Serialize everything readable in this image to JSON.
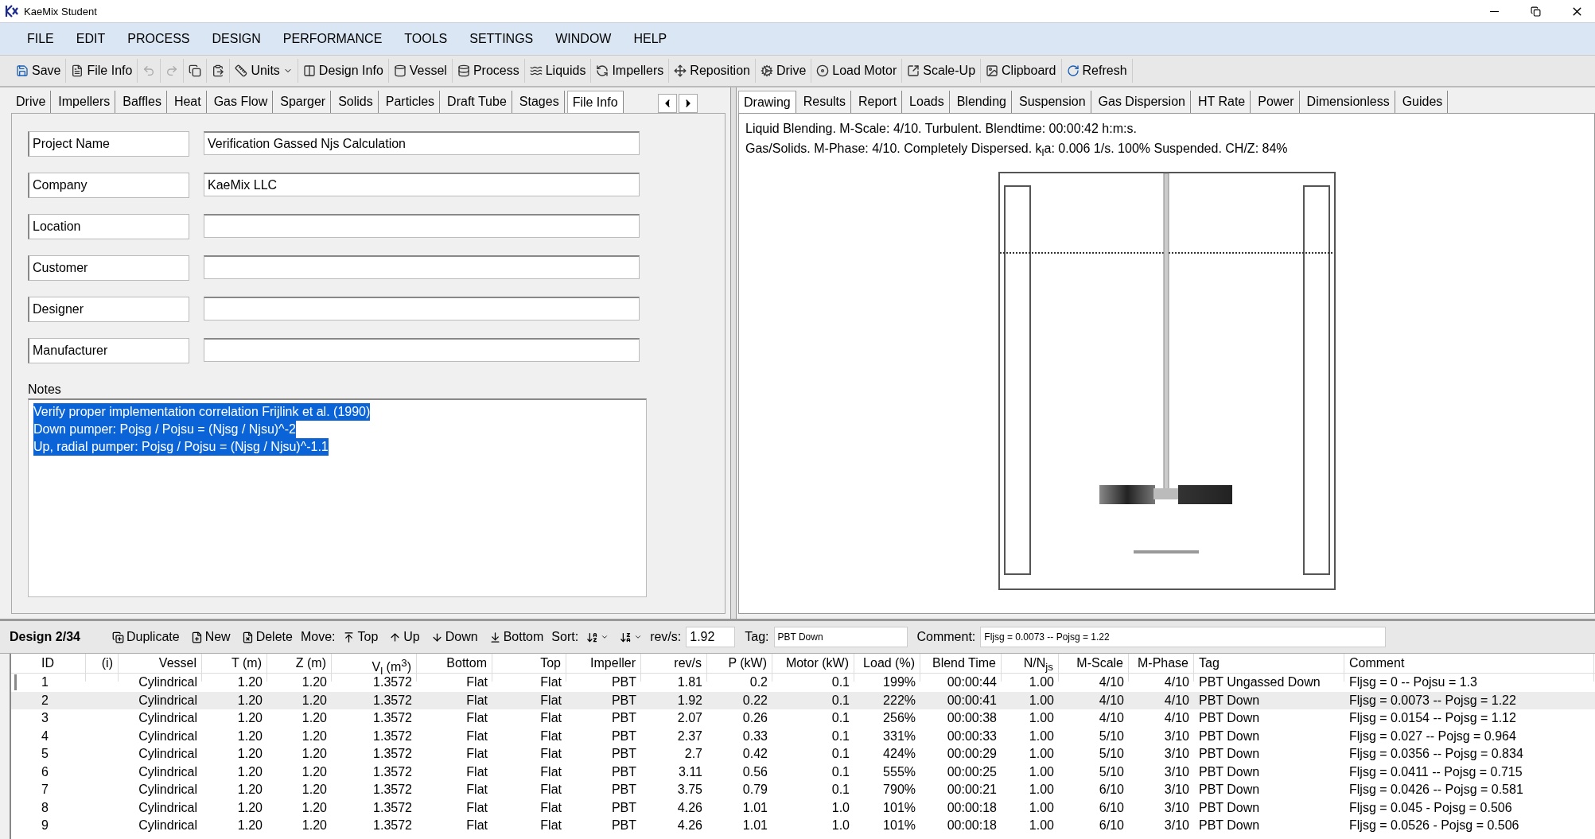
{
  "window": {
    "title": "KaeMix Student"
  },
  "menu": [
    "FILE",
    "EDIT",
    "PROCESS",
    "DESIGN",
    "PERFORMANCE",
    "TOOLS",
    "SETTINGS",
    "WINDOW",
    "HELP"
  ],
  "toolbar": [
    {
      "label": "Save",
      "disabled": false,
      "dropdown": false
    },
    {
      "label": "File Info",
      "disabled": false,
      "dropdown": false
    },
    {
      "disabled": true,
      "dropdown": false
    },
    {
      "disabled": true,
      "dropdown": false
    },
    {
      "disabled": false,
      "dropdown": false
    },
    {
      "disabled": false,
      "dropdown": false
    },
    {
      "label": "Units",
      "disabled": false,
      "dropdown": true
    },
    {
      "label": "Design Info",
      "disabled": false,
      "dropdown": false
    },
    {
      "label": "Vessel",
      "disabled": false,
      "dropdown": false
    },
    {
      "label": "Process",
      "disabled": false,
      "dropdown": false
    },
    {
      "label": "Liquids",
      "disabled": false,
      "dropdown": false
    },
    {
      "label": "Impellers",
      "disabled": false,
      "dropdown": false
    },
    {
      "label": "Reposition",
      "disabled": false,
      "dropdown": false
    },
    {
      "label": "Drive",
      "disabled": false,
      "dropdown": false
    },
    {
      "label": "Load Motor",
      "disabled": false,
      "dropdown": false
    },
    {
      "label": "Scale-Up",
      "disabled": false,
      "dropdown": false
    },
    {
      "label": "Clipboard",
      "disabled": false,
      "dropdown": false
    },
    {
      "label": "Refresh",
      "disabled": false,
      "dropdown": false
    }
  ],
  "left_tabs": [
    {
      "label": "Drive",
      "selected": false
    },
    {
      "label": "Impellers",
      "selected": false
    },
    {
      "label": "Baffles",
      "selected": false
    },
    {
      "label": "Heat",
      "selected": false
    },
    {
      "label": "Gas Flow",
      "selected": false
    },
    {
      "label": "Sparger",
      "selected": false
    },
    {
      "label": "Solids",
      "selected": false
    },
    {
      "label": "Particles",
      "selected": false
    },
    {
      "label": "Draft Tube",
      "selected": false
    },
    {
      "label": "Stages",
      "selected": false
    },
    {
      "label": "File Info",
      "selected": true
    }
  ],
  "right_tabs": [
    {
      "label": "Drawing",
      "selected": true
    },
    {
      "label": "Results",
      "selected": false
    },
    {
      "label": "Report",
      "selected": false
    },
    {
      "label": "Loads",
      "selected": false
    },
    {
      "label": "Blending",
      "selected": false
    },
    {
      "label": "Suspension",
      "selected": false
    },
    {
      "label": "Gas Dispersion",
      "selected": false
    },
    {
      "label": "HT Rate",
      "selected": false
    },
    {
      "label": "Power",
      "selected": false
    },
    {
      "label": "Dimensionless",
      "selected": false
    },
    {
      "label": "Guides",
      "selected": false
    }
  ],
  "fields": [
    {
      "label": "Project Name",
      "value": "Verification Gassed Njs Calculation"
    },
    {
      "label": "Company",
      "value": "KaeMix LLC"
    },
    {
      "label": "Location"
    },
    {
      "label": "Customer"
    },
    {
      "label": "Designer"
    },
    {
      "label": "Manufacturer"
    }
  ],
  "notes": {
    "label": "Notes",
    "selected": true,
    "lines": [
      "Verify proper implementation correlation Frijlink et al. (1990)",
      "Down pumper: Pojsg / Pojsu = (Njsg / Njsu)^-2",
      "Up, radial pumper: Pojsg / Pojsu = (Njsg / Njsu)^-1.1"
    ]
  },
  "summary": [
    "Liquid Blending. M-Scale: 4/10. Turbulent. Blendtime: 00:00:42 h:m:s.",
    "Gas/Solids. M-Phase: 4/10. Completely Dispersed. k$_{l}$a: 0.006 1/s. 100% Suspended. CH/Z: 84%"
  ],
  "design_bar": {
    "title": "Design 2/34",
    "actions": [
      "Duplicate",
      "New",
      "Delete"
    ],
    "move_label": "Move:",
    "move": [
      "Top",
      "Up",
      "Down",
      "Bottom"
    ],
    "sort_label": "Sort:",
    "rev_label": "rev/s:",
    "rev_value": "1.92",
    "tag_label": "Tag:",
    "tag_value": "PBT Down",
    "comment_label": "Comment:",
    "comment_value": "Fljsg = 0.0073 -- Pojsg = 1.22"
  },
  "table": {
    "columns": [
      "ID",
      "(i)",
      "Vessel",
      "T (m)",
      "Z (m)",
      "V$_{l}$ (m$^{3}$)",
      "Bottom",
      "Top",
      "Impeller",
      "rev/s",
      "P (kW)",
      "Motor (kW)",
      "Load (%)",
      "Blend Time",
      "N/N$_{js}$",
      "M-Scale",
      "M-Phase",
      "Tag",
      "Comment"
    ],
    "rows": [
      {
        "selected": false,
        "cells": [
          "1",
          null,
          "Cylindrical",
          "1.20",
          "1.20",
          "1.3572",
          "Flat",
          "Flat",
          "PBT",
          "1.81",
          "0.2",
          "0.1",
          "199%",
          "00:00:44",
          "1.00",
          "4/10",
          "4/10",
          "PBT Ungassed Down",
          "Fljsg = 0 -- Pojsu = 1.3"
        ]
      },
      {
        "selected": true,
        "cells": [
          "2",
          null,
          "Cylindrical",
          "1.20",
          "1.20",
          "1.3572",
          "Flat",
          "Flat",
          "PBT",
          "1.92",
          "0.22",
          "0.1",
          "222%",
          "00:00:41",
          "1.00",
          "4/10",
          "4/10",
          "PBT Down",
          "Fljsg = 0.0073 -- Pojsg = 1.22"
        ]
      },
      {
        "selected": false,
        "cells": [
          "3",
          null,
          "Cylindrical",
          "1.20",
          "1.20",
          "1.3572",
          "Flat",
          "Flat",
          "PBT",
          "2.07",
          "0.26",
          "0.1",
          "256%",
          "00:00:38",
          "1.00",
          "4/10",
          "4/10",
          "PBT Down",
          "Fljsg = 0.0154 -- Pojsg = 1.12"
        ]
      },
      {
        "selected": false,
        "cells": [
          "4",
          null,
          "Cylindrical",
          "1.20",
          "1.20",
          "1.3572",
          "Flat",
          "Flat",
          "PBT",
          "2.37",
          "0.33",
          "0.1",
          "331%",
          "00:00:33",
          "1.00",
          "5/10",
          "3/10",
          "PBT Down",
          "Fljsg = 0.027 -- Pojsg = 0.964"
        ]
      },
      {
        "selected": false,
        "cells": [
          "5",
          null,
          "Cylindrical",
          "1.20",
          "1.20",
          "1.3572",
          "Flat",
          "Flat",
          "PBT",
          "2.7",
          "0.42",
          "0.1",
          "424%",
          "00:00:29",
          "1.00",
          "5/10",
          "3/10",
          "PBT Down",
          "Fljsg = 0.0356 -- Pojsg = 0.834"
        ]
      },
      {
        "selected": false,
        "cells": [
          "6",
          null,
          "Cylindrical",
          "1.20",
          "1.20",
          "1.3572",
          "Flat",
          "Flat",
          "PBT",
          "3.11",
          "0.56",
          "0.1",
          "555%",
          "00:00:25",
          "1.00",
          "5/10",
          "3/10",
          "PBT Down",
          "Fljsg = 0.0411 -- Pojsg = 0.715"
        ]
      },
      {
        "selected": false,
        "cells": [
          "7",
          null,
          "Cylindrical",
          "1.20",
          "1.20",
          "1.3572",
          "Flat",
          "Flat",
          "PBT",
          "3.75",
          "0.79",
          "0.1",
          "790%",
          "00:00:21",
          "1.00",
          "6/10",
          "3/10",
          "PBT Down",
          "Fljsg = 0.0426 -- Pojsg = 0.581"
        ]
      },
      {
        "selected": false,
        "cells": [
          "8",
          null,
          "Cylindrical",
          "1.20",
          "1.20",
          "1.3572",
          "Flat",
          "Flat",
          "PBT",
          "4.26",
          "1.01",
          "1.0",
          "101%",
          "00:00:18",
          "1.00",
          "6/10",
          "3/10",
          "PBT Down",
          "Fljsg = 0.045 - Pojsg = 0.506"
        ]
      },
      {
        "selected": false,
        "cells": [
          "9",
          null,
          "Cylindrical",
          "1.20",
          "1.20",
          "1.3572",
          "Flat",
          "Flat",
          "PBT",
          "4.26",
          "1.01",
          "1.0",
          "101%",
          "00:00:18",
          "1.00",
          "6/10",
          "3/10",
          "PBT Down",
          "Fljsg = 0.0526 - Pojsg = 0.506"
        ]
      }
    ]
  }
}
